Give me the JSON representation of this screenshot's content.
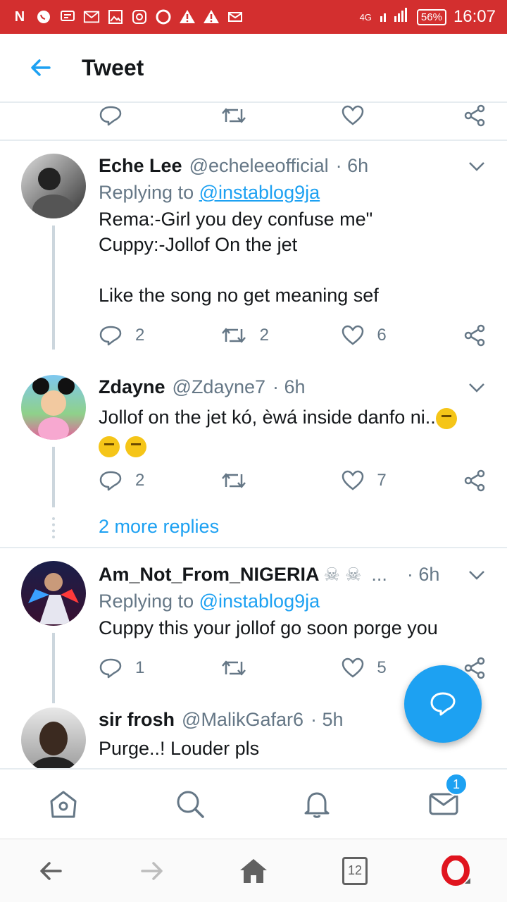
{
  "status_bar": {
    "time": "16:07",
    "battery": "56%",
    "network": "4G",
    "left_icons": [
      "notification-n-icon",
      "whatsapp-icon",
      "message-icon",
      "gmail-icon",
      "gallery-icon",
      "instagram-icon",
      "opera-icon",
      "warning-icon",
      "warning-icon",
      "mail-icon"
    ]
  },
  "header": {
    "title": "Tweet"
  },
  "tweets": [
    {
      "name": "Eche Lee",
      "handle": "@echeleeofficial",
      "time": "· 6h",
      "replying_label": "Replying to ",
      "replying_to": "@instablog9ja",
      "text": "Rema:-Girl you dey confuse me\"\nCuppy:-Jollof On the jet\n\nLike the song no get meaning sef",
      "replies": "2",
      "retweets": "2",
      "likes": "6"
    },
    {
      "name": "Zdayne",
      "handle": "@Zdayne7",
      "time": "· 6h",
      "text": "Jollof on the jet kó, èwá inside danfo ni..",
      "replies": "2",
      "retweets": "",
      "likes": "7"
    },
    {
      "name": "Am_Not_From_NIGERIA",
      "handle": "...",
      "time": "· 6h",
      "replying_label": "Replying to ",
      "replying_to": "@instablog9ja",
      "text": "Cuppy this your jollof go soon porge you",
      "replies": "1",
      "retweets": "",
      "likes": "5"
    },
    {
      "name": "sir frosh",
      "handle": "@MalikGafar6",
      "time": "· 5h",
      "text": "Purge..! Louder pls"
    }
  ],
  "more_replies": "2 more replies",
  "bottom_nav": {
    "items": [
      "home-icon",
      "search-icon",
      "notifications-icon",
      "messages-icon"
    ],
    "messages_badge": "1"
  },
  "browser_bar": {
    "tab_count": "12"
  },
  "colors": {
    "status_bar": "#d32f2f",
    "accent": "#1da1f2",
    "muted": "#657786"
  }
}
